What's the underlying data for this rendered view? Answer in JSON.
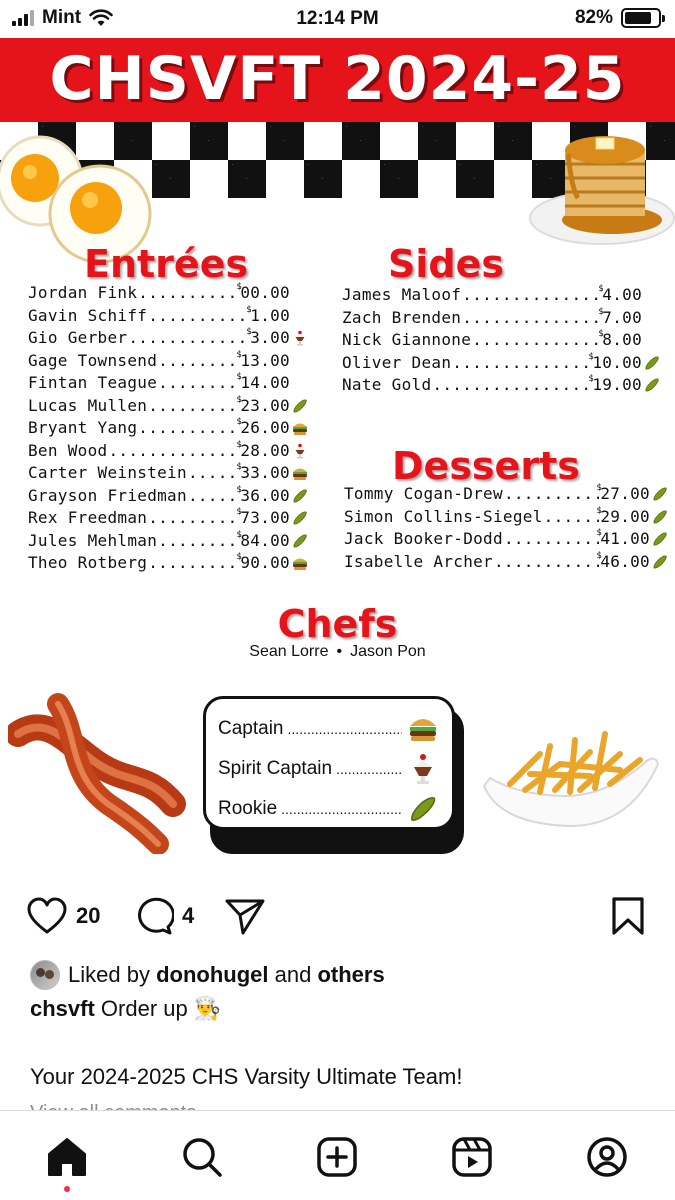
{
  "status_bar": {
    "carrier": "Mint",
    "time": "12:14 PM",
    "battery": "82%",
    "battery_level": 0.82
  },
  "poster": {
    "title": "CHSVFT 2024-25",
    "entrees": {
      "heading": "Entrées",
      "items": [
        {
          "name": "Jordan Fink",
          "price": "00.00",
          "badge": ""
        },
        {
          "name": "Gavin Schiff",
          "price": "1.00",
          "badge": ""
        },
        {
          "name": "Gio Gerber",
          "price": "3.00",
          "badge": "sundae-icon"
        },
        {
          "name": "Gage Townsend",
          "price": "13.00",
          "badge": ""
        },
        {
          "name": "Fintan Teague",
          "price": "14.00",
          "badge": ""
        },
        {
          "name": "Lucas Mullen",
          "price": "23.00",
          "badge": "pickle-icon"
        },
        {
          "name": "Bryant Yang",
          "price": "26.00",
          "badge": "burger-icon"
        },
        {
          "name": "Ben Wood",
          "price": "28.00",
          "badge": "sundae-icon"
        },
        {
          "name": "Carter Weinstein",
          "price": "33.00",
          "badge": "burger-icon"
        },
        {
          "name": "Grayson Friedman",
          "price": "36.00",
          "badge": "pickle-icon"
        },
        {
          "name": "Rex Freedman",
          "price": "73.00",
          "badge": "pickle-icon"
        },
        {
          "name": "Jules Mehlman",
          "price": "84.00",
          "badge": "pickle-icon"
        },
        {
          "name": "Theo Rotberg",
          "price": "90.00",
          "badge": "burger-icon"
        }
      ]
    },
    "sides": {
      "heading": "Sides",
      "items": [
        {
          "name": "James Maloof",
          "price": "4.00",
          "badge": ""
        },
        {
          "name": "Zach Brenden",
          "price": "7.00",
          "badge": ""
        },
        {
          "name": "Nick Giannone",
          "price": "8.00",
          "badge": ""
        },
        {
          "name": "Oliver Dean",
          "price": "10.00",
          "badge": "pickle-icon"
        },
        {
          "name": "Nate Gold",
          "price": "19.00",
          "badge": "pickle-icon"
        }
      ]
    },
    "desserts": {
      "heading": "Desserts",
      "items": [
        {
          "name": "Tommy Cogan-Drew",
          "price": "27.00",
          "badge": "pickle-icon"
        },
        {
          "name": "Simon Collins-Siegel",
          "price": "29.00",
          "badge": "pickle-icon"
        },
        {
          "name": "Jack Booker-Dodd",
          "price": "41.00",
          "badge": "pickle-icon"
        },
        {
          "name": "Isabelle Archer",
          "price": "46.00",
          "badge": "pickle-icon"
        }
      ]
    },
    "currency_symbol": "$",
    "chefs": {
      "heading": "Chefs",
      "names": [
        "Sean Lorre",
        "Jason Pon"
      ],
      "separator": "•"
    },
    "legend": [
      {
        "label": "Captain",
        "icon": "burger-icon"
      },
      {
        "label": "Spirit Captain",
        "icon": "sundae-icon"
      },
      {
        "label": "Rookie",
        "icon": "pickle-icon"
      }
    ]
  },
  "actions": {
    "likes": "20",
    "comments": "4"
  },
  "post": {
    "liked_by_prefix": "Liked by",
    "liked_by_user": "donohugel",
    "liked_by_and": "and",
    "liked_by_others": "others",
    "username": "chsvft",
    "caption": "Order up 👨‍🍳",
    "text": "Your 2024-2025 CHS Varsity Ultimate Team!",
    "more": "View all comments"
  },
  "colors": {
    "accent_red": "#e4141a",
    "nav_dot": "#ff2b44"
  }
}
